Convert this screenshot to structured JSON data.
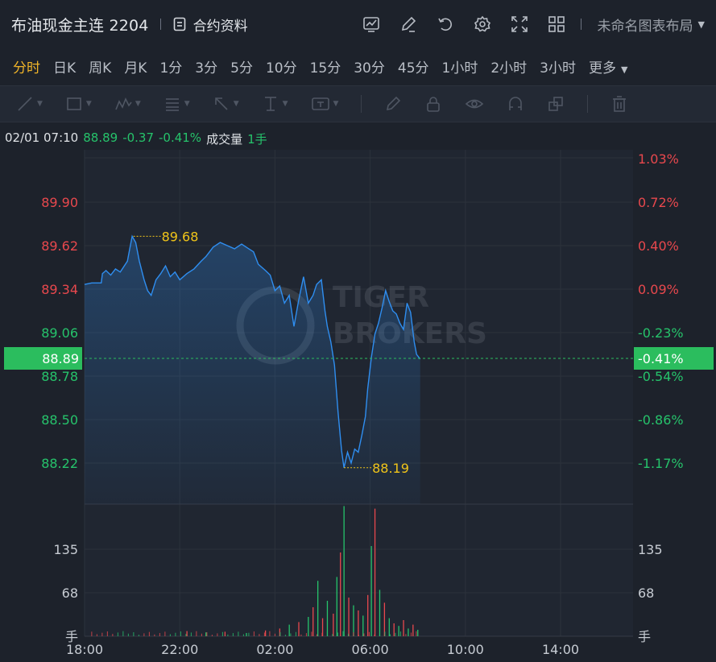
{
  "header": {
    "title": "布油现金主连 2204",
    "contract_label": "合约资料",
    "layout_label": "未命名图表布局"
  },
  "timeframes": [
    "分时",
    "日K",
    "周K",
    "月K",
    "1分",
    "3分",
    "5分",
    "10分",
    "15分",
    "30分",
    "45分",
    "1小时",
    "2小时",
    "3小时",
    "更多"
  ],
  "active_timeframe": "分时",
  "info": {
    "datetime": "02/01 07:10",
    "price": "88.89",
    "change": "-0.37",
    "change_pct": "-0.41%",
    "volume_label": "成交量",
    "volume_value": "1手"
  },
  "watermark": {
    "line1": "TIGER",
    "line2": "BROKERS"
  },
  "colors": {
    "up": "#e8484d",
    "down": "#26c36b",
    "line": "#2f8ef0",
    "current_badge": "#2bbd5e",
    "marker": "#f0c419",
    "background": "#1d222b"
  },
  "chart_data": {
    "type": "line",
    "prev_close": 89.26,
    "current": {
      "price": "88.89",
      "pct": "-0.41%"
    },
    "high_marker": {
      "time": "19:48",
      "value": "89.68"
    },
    "low_marker": {
      "time": "04:25",
      "value": "88.19"
    },
    "y_left_ticks": [
      "89.90",
      "89.62",
      "89.34",
      "89.06",
      "88.78",
      "88.50",
      "88.22"
    ],
    "y_right_ticks": [
      "1.03%",
      "0.72%",
      "0.40%",
      "0.09%",
      "-0.23%",
      "-0.54%",
      "-0.86%",
      "-1.17%"
    ],
    "x_ticks": [
      "18:00",
      "22:00",
      "02:00",
      "06:00",
      "10:00",
      "14:00"
    ],
    "x_unit": "hours since 18:00",
    "price_series": [
      [
        0.0,
        89.37
      ],
      [
        0.3,
        89.38
      ],
      [
        0.7,
        89.38
      ],
      [
        0.75,
        89.44
      ],
      [
        0.9,
        89.46
      ],
      [
        1.1,
        89.43
      ],
      [
        1.3,
        89.47
      ],
      [
        1.5,
        89.45
      ],
      [
        1.8,
        89.52
      ],
      [
        1.9,
        89.6
      ],
      [
        2.0,
        89.68
      ],
      [
        2.15,
        89.64
      ],
      [
        2.3,
        89.52
      ],
      [
        2.5,
        89.4
      ],
      [
        2.65,
        89.33
      ],
      [
        2.8,
        89.3
      ],
      [
        3.0,
        89.4
      ],
      [
        3.2,
        89.44
      ],
      [
        3.4,
        89.49
      ],
      [
        3.6,
        89.42
      ],
      [
        3.8,
        89.45
      ],
      [
        4.0,
        89.4
      ],
      [
        4.3,
        89.44
      ],
      [
        4.6,
        89.47
      ],
      [
        4.9,
        89.52
      ],
      [
        5.1,
        89.55
      ],
      [
        5.4,
        89.61
      ],
      [
        5.7,
        89.64
      ],
      [
        6.0,
        89.62
      ],
      [
        6.3,
        89.6
      ],
      [
        6.6,
        89.63
      ],
      [
        6.9,
        89.6
      ],
      [
        7.1,
        89.58
      ],
      [
        7.3,
        89.5
      ],
      [
        7.6,
        89.46
      ],
      [
        7.8,
        89.43
      ],
      [
        8.0,
        89.33
      ],
      [
        8.2,
        89.36
      ],
      [
        8.4,
        89.25
      ],
      [
        8.6,
        89.3
      ],
      [
        8.8,
        89.1
      ],
      [
        9.0,
        89.27
      ],
      [
        9.2,
        89.42
      ],
      [
        9.4,
        89.25
      ],
      [
        9.6,
        89.3
      ],
      [
        9.75,
        89.37
      ],
      [
        9.95,
        89.4
      ],
      [
        10.1,
        89.2
      ],
      [
        10.2,
        89.1
      ],
      [
        10.35,
        89.0
      ],
      [
        10.5,
        88.85
      ],
      [
        10.65,
        88.55
      ],
      [
        10.8,
        88.3
      ],
      [
        10.9,
        88.19
      ],
      [
        11.05,
        88.29
      ],
      [
        11.2,
        88.22
      ],
      [
        11.35,
        88.31
      ],
      [
        11.5,
        88.29
      ],
      [
        11.65,
        88.4
      ],
      [
        11.8,
        88.52
      ],
      [
        11.9,
        88.7
      ],
      [
        12.05,
        88.9
      ],
      [
        12.2,
        89.05
      ],
      [
        12.35,
        89.12
      ],
      [
        12.5,
        89.22
      ],
      [
        12.65,
        89.33
      ],
      [
        12.8,
        89.26
      ],
      [
        12.95,
        89.2
      ],
      [
        13.1,
        89.18
      ],
      [
        13.25,
        89.12
      ],
      [
        13.4,
        89.08
      ],
      [
        13.55,
        89.25
      ],
      [
        13.7,
        89.19
      ],
      [
        13.85,
        89.0
      ],
      [
        13.95,
        88.92
      ],
      [
        14.1,
        88.89
      ]
    ],
    "volume_ticks": [
      "135",
      "68",
      "手"
    ],
    "volume_max": 202,
    "volume_series": [
      [
        4.3,
        8,
        "up"
      ],
      [
        5.1,
        6,
        "down"
      ],
      [
        5.9,
        7,
        "up"
      ],
      [
        6.8,
        5,
        "down"
      ],
      [
        7.6,
        9,
        "up"
      ],
      [
        8.2,
        12,
        "up"
      ],
      [
        8.6,
        18,
        "down"
      ],
      [
        9.0,
        22,
        "up"
      ],
      [
        9.4,
        30,
        "down"
      ],
      [
        9.6,
        45,
        "up"
      ],
      [
        9.8,
        86,
        "down"
      ],
      [
        10.0,
        28,
        "up"
      ],
      [
        10.2,
        55,
        "down"
      ],
      [
        10.45,
        35,
        "up"
      ],
      [
        10.6,
        92,
        "down"
      ],
      [
        10.75,
        130,
        "up"
      ],
      [
        10.9,
        202,
        "down"
      ],
      [
        11.1,
        60,
        "up"
      ],
      [
        11.3,
        48,
        "down"
      ],
      [
        11.5,
        40,
        "up"
      ],
      [
        11.7,
        32,
        "down"
      ],
      [
        11.9,
        64,
        "up"
      ],
      [
        12.05,
        140,
        "down"
      ],
      [
        12.2,
        198,
        "up"
      ],
      [
        12.4,
        72,
        "down"
      ],
      [
        12.6,
        52,
        "up"
      ],
      [
        12.8,
        28,
        "down"
      ],
      [
        13.0,
        20,
        "up"
      ],
      [
        13.2,
        16,
        "down"
      ],
      [
        13.4,
        25,
        "up"
      ],
      [
        13.6,
        12,
        "down"
      ],
      [
        13.8,
        18,
        "up"
      ],
      [
        14.0,
        10,
        "down"
      ]
    ]
  }
}
